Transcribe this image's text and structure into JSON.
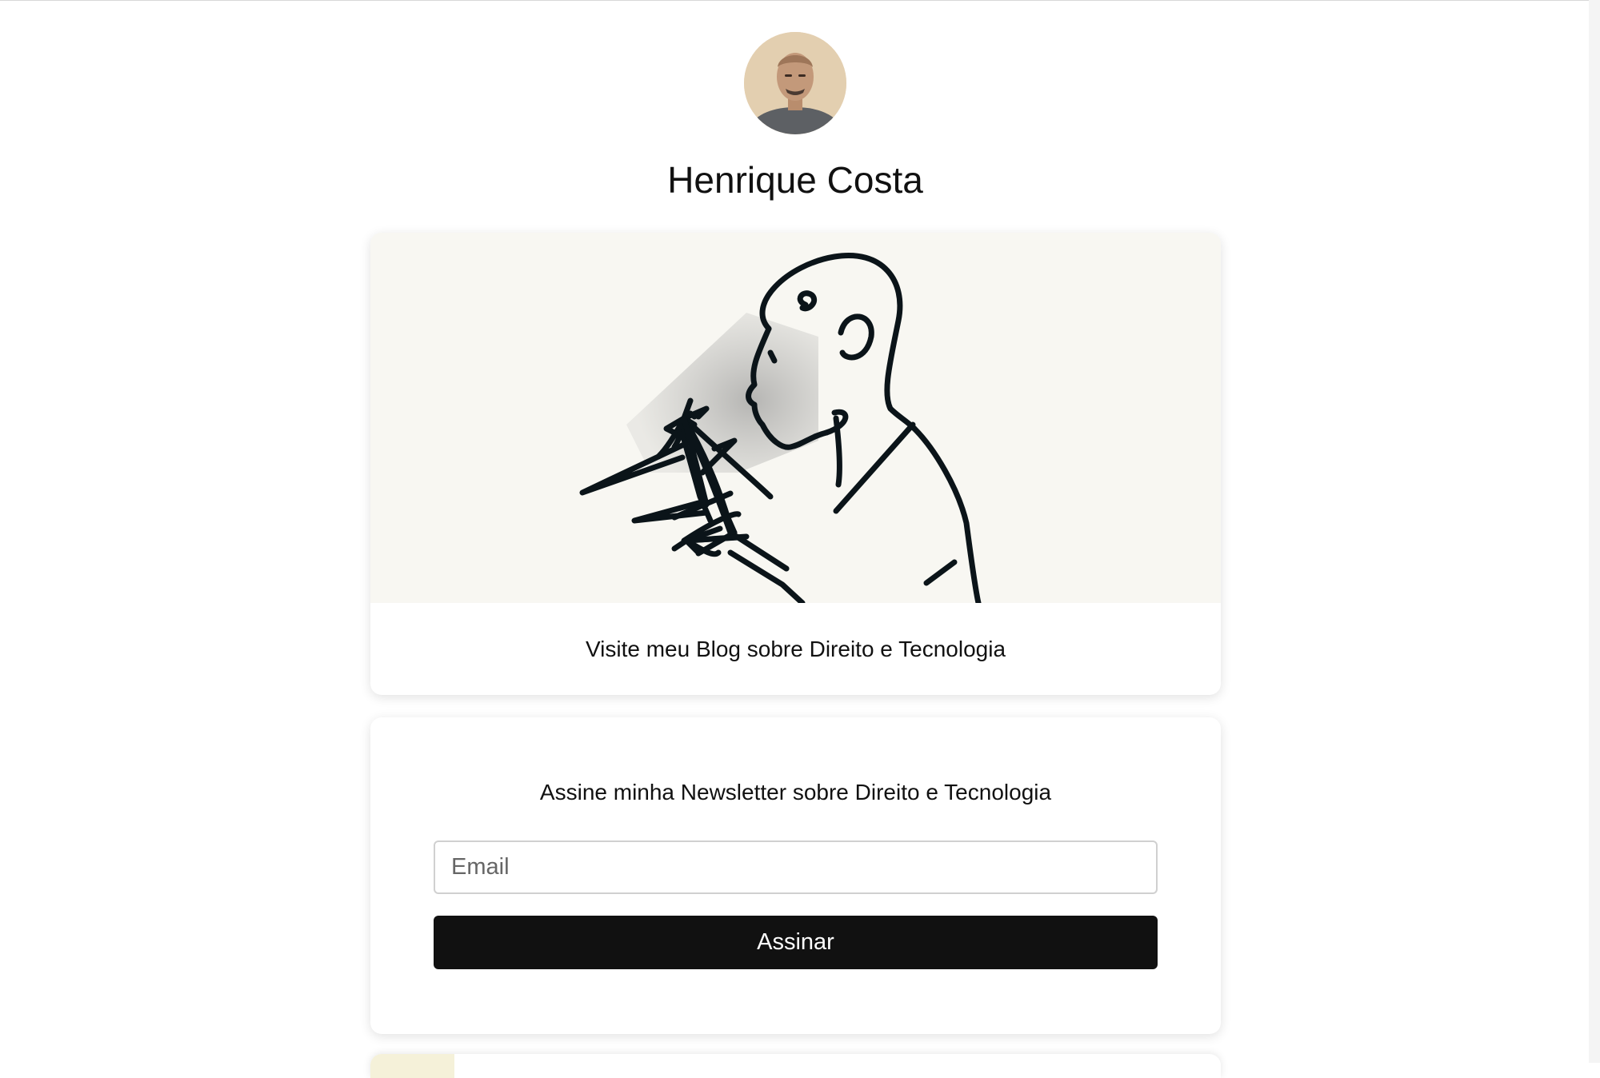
{
  "profile": {
    "name": "Henrique Costa",
    "avatar_icon": "profile-photo"
  },
  "blog_card": {
    "label": "Visite meu Blog sobre Direito e Tecnologia",
    "illustration": "person-looking-at-phone-illustration"
  },
  "newsletter": {
    "title": "Assine minha Newsletter sobre Direito e Tecnologia",
    "email_placeholder": "Email",
    "button_label": "Assinar"
  },
  "colors": {
    "page_background": "#ffffff",
    "image_background": "#f8f7f2",
    "button_background": "#111111",
    "button_text": "#ffffff",
    "ink": "#0b1419"
  }
}
